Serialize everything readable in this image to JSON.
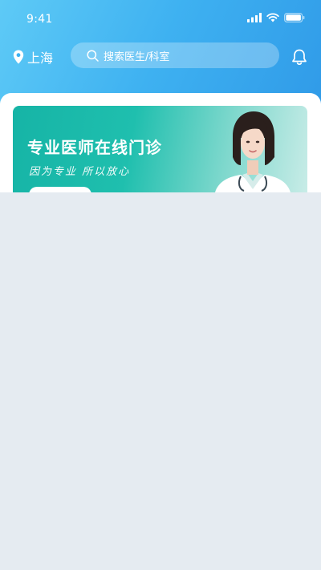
{
  "status_bar": {
    "time": "9:41"
  },
  "nav": {
    "location": "上海",
    "search_placeholder": "搜索医生/科室"
  },
  "banner": {
    "title": "专业医师在线门诊",
    "subtitle": "因为专业 所以放心"
  },
  "colors": {
    "header_gradient_start": "#5ecaf6",
    "header_gradient_end": "#2d96e6",
    "banner_teal": "#1fbfae",
    "page_background": "#e5ebf1"
  },
  "icons": [
    "signal-icon",
    "wifi-icon",
    "battery-icon",
    "location-pin-icon",
    "search-icon",
    "bell-icon"
  ]
}
